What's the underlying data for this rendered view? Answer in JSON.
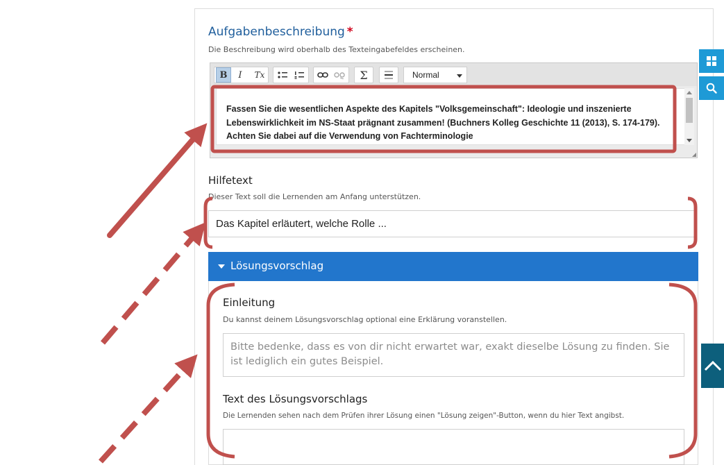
{
  "task_description": {
    "title": "Aufgabenbeschreibung",
    "required_marker": "*",
    "description": "Die Beschreibung wird oberhalb des Texteingabefeldes erscheinen.",
    "text_lines": [
      "Fassen Sie die wesentlichen Aspekte des Kapitels \"Volksgemeinschaft\": Ideologie und inszenierte",
      "Lebenswirklichkeit im NS-Staat prägnant zusammen! (Buchners Kolleg Geschichte 11 (2013), S. 174-179).",
      "Achten Sie dabei auf die Verwendung von Fachterminologie"
    ]
  },
  "toolbar": {
    "bold": "B",
    "italic": "I",
    "clear_format": "Tx",
    "sum": "Σ",
    "format_select": "Normal"
  },
  "help_text": {
    "title": "Hilfetext",
    "description": "Dieser Text soll die Lernenden am Anfang unterstützen.",
    "value": "Das Kapitel erläutert, welche Rolle ..."
  },
  "solution": {
    "header": "Lösungsvorschlag",
    "intro": {
      "title": "Einleitung",
      "description": "Du kannst deinem Lösungsvorschlag optional eine Erklärung voranstellen.",
      "placeholder_lines": [
        "Bitte bedenke, dass es von dir nicht erwartet war, exakt dieselbe Lösung zu finden. Sie",
        "ist lediglich ein gutes Beispiel."
      ]
    },
    "text": {
      "title": "Text des Lösungsvorschlags",
      "description": "Die Lernenden sehen nach dem Prüfen ihrer Lösung einen \"Lösung zeigen\"-Button, wenn du hier Text angibst.",
      "value": ""
    }
  },
  "icons": {
    "side_top": "grid-icon",
    "side_bottom": "search-icon",
    "scroll_top": "chevron-up-icon"
  },
  "colors": {
    "title_blue": "#1f5e9c",
    "accordion_blue": "#2276cc",
    "annotation_red": "#c0504d",
    "side_blue": "#1e9ad6",
    "scroll_top_teal": "#0d5f7c"
  }
}
